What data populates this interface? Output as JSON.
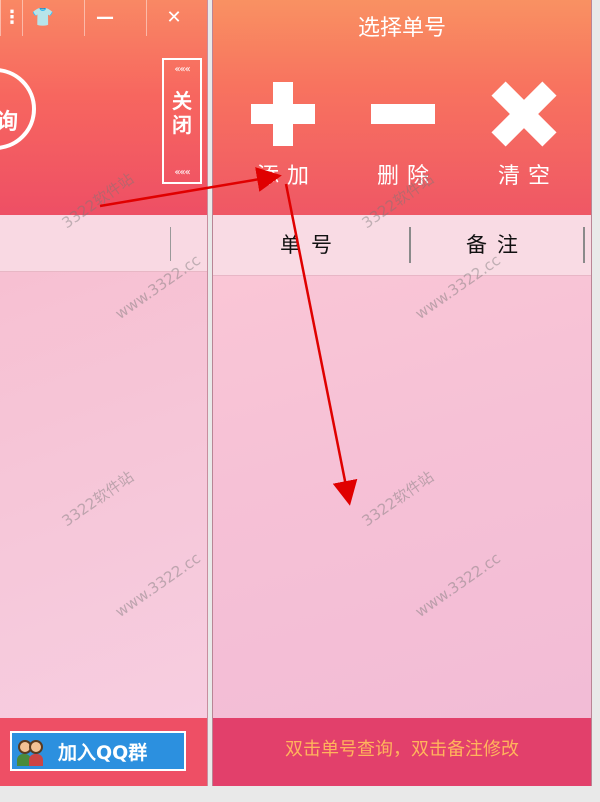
{
  "left_window": {
    "title_button_1": "👕",
    "title_button_2": "—",
    "title_button_3": "✕",
    "circle_text": "询",
    "close_label": "关闭",
    "close_arrows": "«««",
    "qq_button": "加入QQ群"
  },
  "right_window": {
    "title": "选择单号",
    "toolbar": {
      "add_label": "添加",
      "delete_label": "删除",
      "clear_label": "清空"
    },
    "columns": [
      "单号",
      "备注"
    ],
    "status_hint": "双击单号查询，双击备注修改"
  },
  "watermarks": [
    "3322软件站",
    "www.3322.cc"
  ],
  "colors": {
    "header_top": "#f99162",
    "header_bottom": "#ef5765",
    "list_bg": "#f7c2d4",
    "status_bar": "#e2406b",
    "status_text": "#ffb45c",
    "annotation_arrow": "#e00000"
  }
}
